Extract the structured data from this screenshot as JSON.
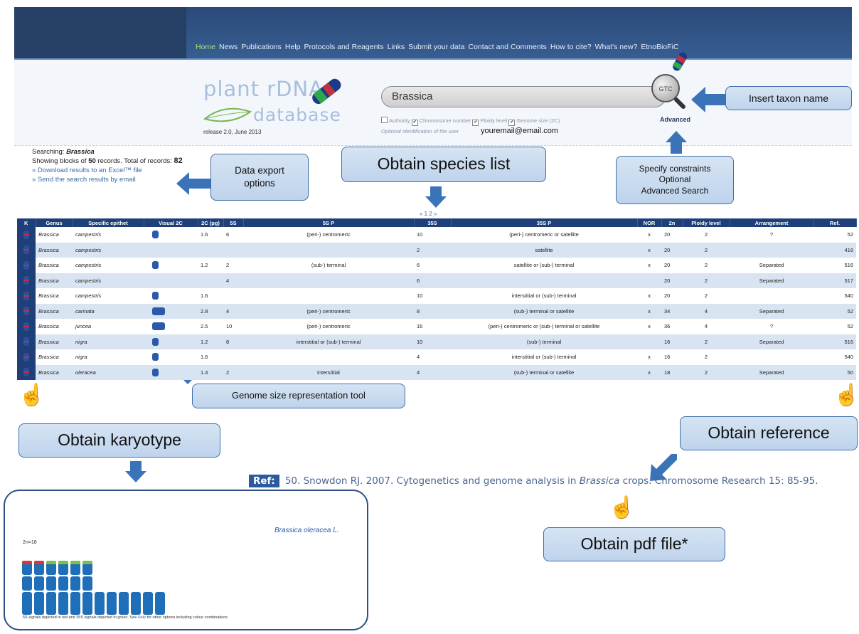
{
  "nav": {
    "items": [
      "Home",
      "News",
      "Publications",
      "Help",
      "Protocols and Reagents",
      "Links",
      "Submit your data",
      "Contact and Comments",
      "How to cite?",
      "What's new?",
      "EtnoBioFiC"
    ]
  },
  "logo": {
    "line1": "plant rDNA",
    "line2": "database",
    "release": "release 2.0, June 2013"
  },
  "search": {
    "value": "Brassica",
    "button_label": "GTC",
    "options": [
      "Authority",
      "Chromosome number",
      "Ploidy level",
      "Genome size (2C)"
    ],
    "options_checked": [
      false,
      true,
      true,
      true
    ],
    "optional_user_label": "Optional identification of the user",
    "email": "youremail@email.com",
    "advanced": "Advanced"
  },
  "results_info": {
    "searching_label": "Searching:",
    "searching_term": "Brassica",
    "showing_prefix": "Showing blocks of",
    "block_size": "50",
    "records_mid": "records. Total of records:",
    "total": "82",
    "download_link": "» Download results to an Excel™ file",
    "email_link": "» Send the search results by email"
  },
  "pager": "« 1 2 »",
  "table": {
    "headers": [
      "K",
      "Genus",
      "Specific epithet",
      "Visual 2C",
      "2C (pg)",
      "5S",
      "5S P",
      "35S",
      "35S P",
      "NOR",
      "2n",
      "Ploidy level",
      "Arrangement",
      "Ref."
    ],
    "rows": [
      {
        "genus": "Brassica",
        "epithet": "campestris",
        "visual": 1,
        "c2": "1.6",
        "s5": "6",
        "s5p": "(peri-) centromeric",
        "s35": "10",
        "s35p": "(peri-) centromeric or satellite",
        "nor": "x",
        "n2": "20",
        "ploidy": "2",
        "arr": "?",
        "ref": "52"
      },
      {
        "genus": "Brassica",
        "epithet": "campestris",
        "visual": 0,
        "c2": "",
        "s5": "",
        "s5p": "",
        "s35": "2",
        "s35p": "satellite",
        "nor": "x",
        "n2": "20",
        "ploidy": "2",
        "arr": "",
        "ref": "416"
      },
      {
        "genus": "Brassica",
        "epithet": "campestris",
        "visual": 1,
        "c2": "1.2",
        "s5": "2",
        "s5p": "(sub-) terminal",
        "s35": "6",
        "s35p": "satellite or (sub-) terminal",
        "nor": "x",
        "n2": "20",
        "ploidy": "2",
        "arr": "Separated",
        "ref": "516"
      },
      {
        "genus": "Brassica",
        "epithet": "campestris",
        "visual": 0,
        "c2": "",
        "s5": "4",
        "s5p": "",
        "s35": "6",
        "s35p": "",
        "nor": "",
        "n2": "20",
        "ploidy": "2",
        "arr": "Separated",
        "ref": "517"
      },
      {
        "genus": "Brassica",
        "epithet": "campestris",
        "visual": 1,
        "c2": "1.6",
        "s5": "",
        "s5p": "",
        "s35": "10",
        "s35p": "interstitial or (sub-) terminal",
        "nor": "x",
        "n2": "20",
        "ploidy": "2",
        "arr": "",
        "ref": "540"
      },
      {
        "genus": "Brassica",
        "epithet": "carinata",
        "visual": 2,
        "c2": "2.8",
        "s5": "4",
        "s5p": "(peri-) centromeric",
        "s35": "8",
        "s35p": "(sub-) terminal or satellite",
        "nor": "x",
        "n2": "34",
        "ploidy": "4",
        "arr": "Separated",
        "ref": "52"
      },
      {
        "genus": "Brassica",
        "epithet": "juncea",
        "visual": 2,
        "c2": "2.5",
        "s5": "10",
        "s5p": "(peri-) centromeric",
        "s35": "16",
        "s35p": "(peri-) centromeric or (sub-) terminal or satellite",
        "nor": "x",
        "n2": "36",
        "ploidy": "4",
        "arr": "?",
        "ref": "52"
      },
      {
        "genus": "Brassica",
        "epithet": "nigra",
        "visual": 1,
        "c2": "1.2",
        "s5": "8",
        "s5p": "interstitial or (sub-) terminal",
        "s35": "10",
        "s35p": "(sub-) terminal",
        "nor": "",
        "n2": "16",
        "ploidy": "2",
        "arr": "Separated",
        "ref": "516"
      },
      {
        "genus": "Brassica",
        "epithet": "nigra",
        "visual": 1,
        "c2": "1.6",
        "s5": "",
        "s5p": "",
        "s35": "4",
        "s35p": "interstitial or (sub-) terminal",
        "nor": "x",
        "n2": "16",
        "ploidy": "2",
        "arr": "",
        "ref": "540"
      },
      {
        "genus": "Brassica",
        "epithet": "oleracea",
        "visual": 1,
        "c2": "1.4",
        "s5": "2",
        "s5p": "interstitial",
        "s35": "4",
        "s35p": "(sub-) terminal or satellite",
        "nor": "x",
        "n2": "18",
        "ploidy": "2",
        "arr": "Separated",
        "ref": "50"
      }
    ]
  },
  "callouts": {
    "insert_taxon": "Insert taxon name",
    "data_export": "Data export options",
    "species_list": "Obtain species list",
    "constraints": [
      "Specify constraints",
      "Optional",
      "Advanced Search"
    ],
    "genome_tool": "Genome size representation tool",
    "karyotype": "Obtain karyotype",
    "reference": "Obtain reference",
    "pdf": "Obtain pdf file*"
  },
  "reference": {
    "tag": "Ref:",
    "before": "50. Snowdon RJ. 2007. Cytogenetics and genome analysis in",
    "italic": "Brassica",
    "after": "crops. Chromosome Research 15: 85-95."
  },
  "karyotype": {
    "species": "Brassica oleracea L.",
    "ploidy": "2n=18",
    "note_before": "5S signals depicted in red and 35S signals depicted in green. See",
    "note_link": "Help",
    "note_after": "for other options including colour combinations"
  },
  "colors": {
    "header": "#2b4a78",
    "callout_fill": "#c9dbef",
    "callout_border": "#3e6ea8",
    "chromosome": "#1f6fb8",
    "signal_5s": "#d23a3a",
    "signal_35s": "#7cc04a"
  }
}
